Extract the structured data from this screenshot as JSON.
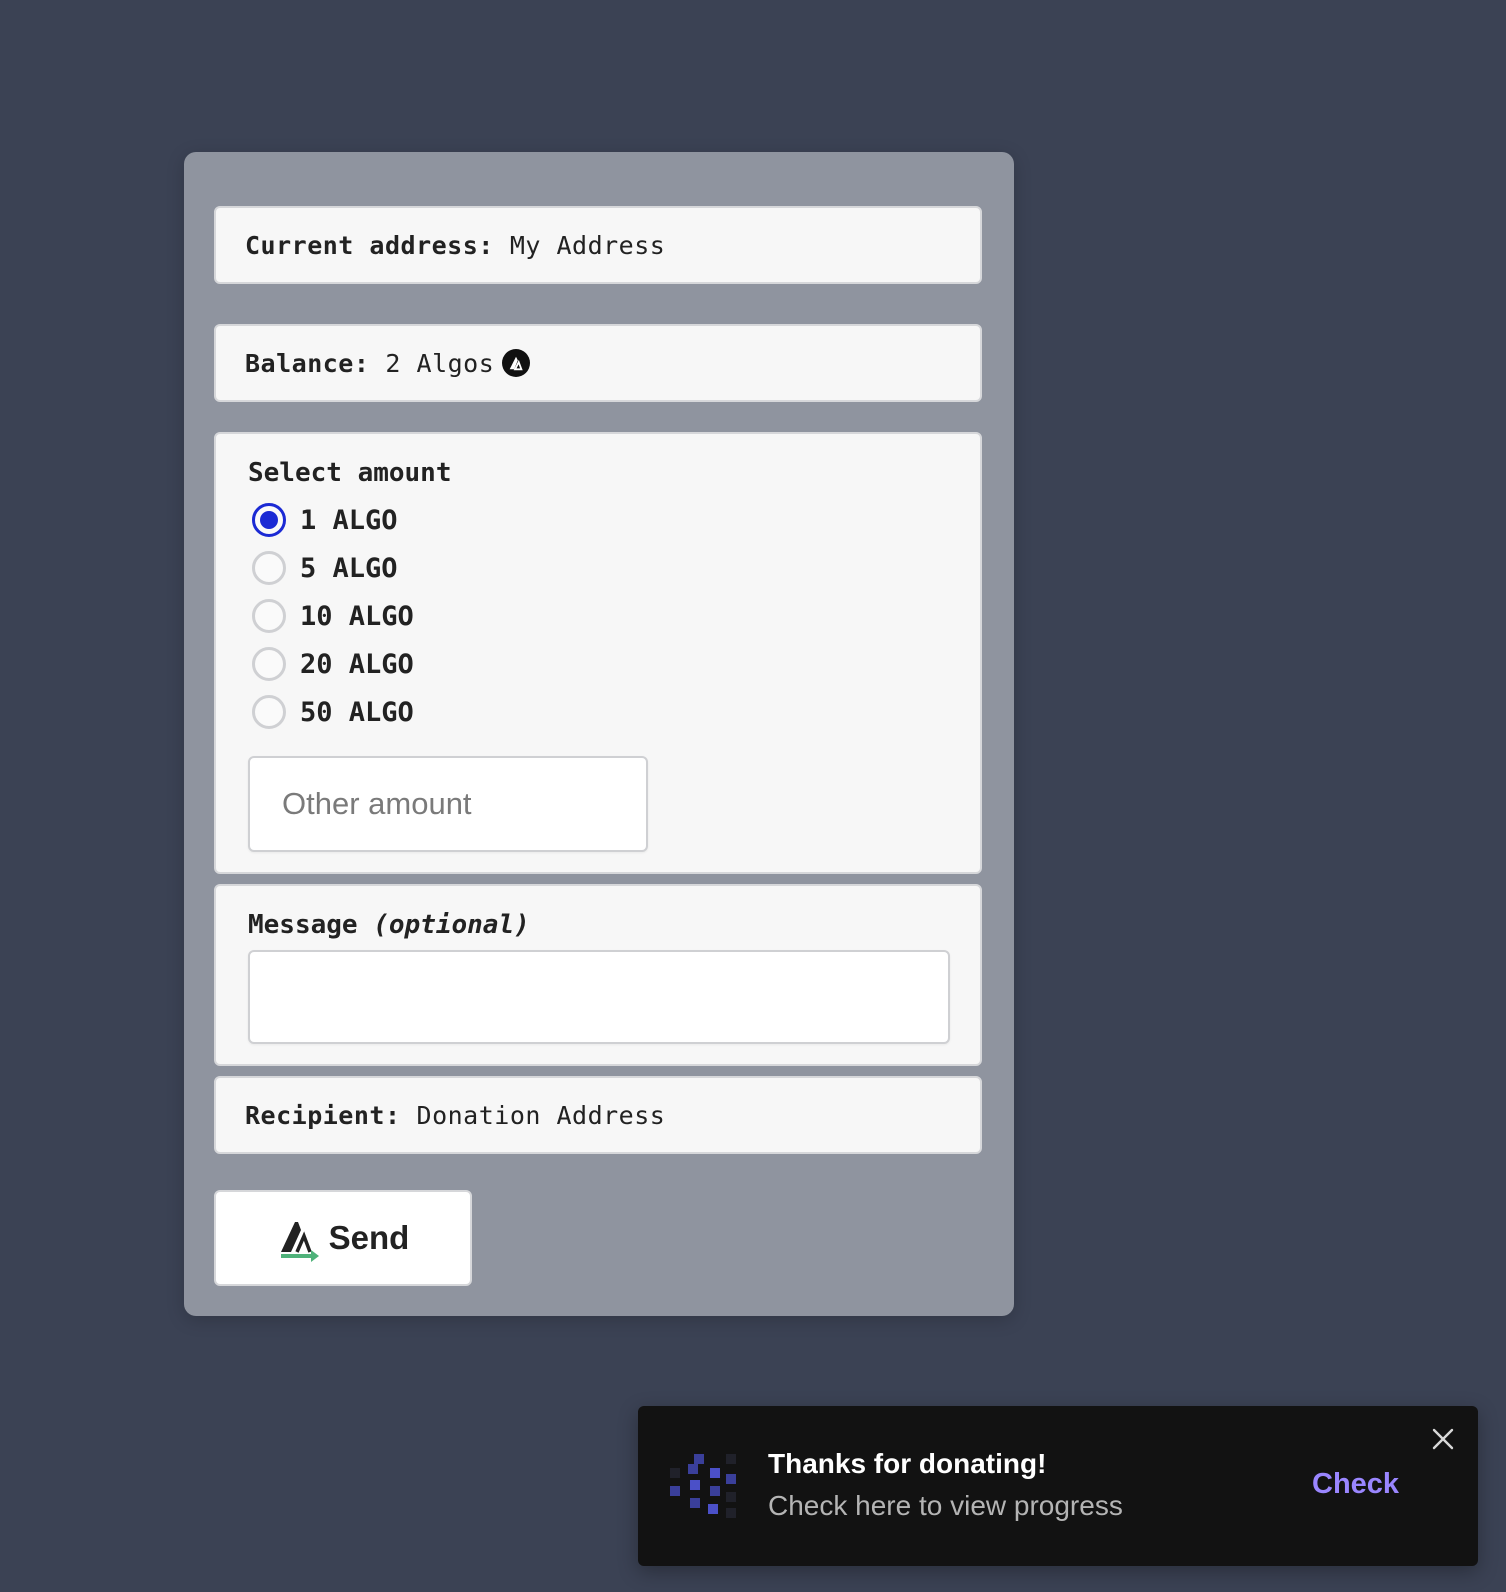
{
  "form": {
    "current_address": {
      "label": "Current address:",
      "value": "My Address"
    },
    "balance": {
      "label": "Balance:",
      "value": "2 Algos",
      "icon": "algorand-logo-icon"
    },
    "amount": {
      "title": "Select amount",
      "options": [
        "1 ALGO",
        "5 ALGO",
        "10 ALGO",
        "20 ALGO",
        "50 ALGO"
      ],
      "selected": "1 ALGO",
      "other_placeholder": "Other amount",
      "other_value": ""
    },
    "message": {
      "title": "Message",
      "title_suffix": "(optional)",
      "value": ""
    },
    "recipient": {
      "label": "Recipient:",
      "value": "Donation Address"
    },
    "send_button": {
      "label": "Send",
      "icon": "algorand-send-icon"
    }
  },
  "toast": {
    "title": "Thanks for donating!",
    "subtitle": "Check here to view progress",
    "action": "Check",
    "icon": "pixel-logo-icon",
    "close_icon": "close-icon"
  },
  "colors": {
    "background": "#3b4254",
    "card": "#8f949f",
    "radio_selected": "#1b2ad4",
    "toast_bg": "#121212",
    "toast_action": "#9a86ff",
    "send_arrow": "#4fb27a"
  }
}
